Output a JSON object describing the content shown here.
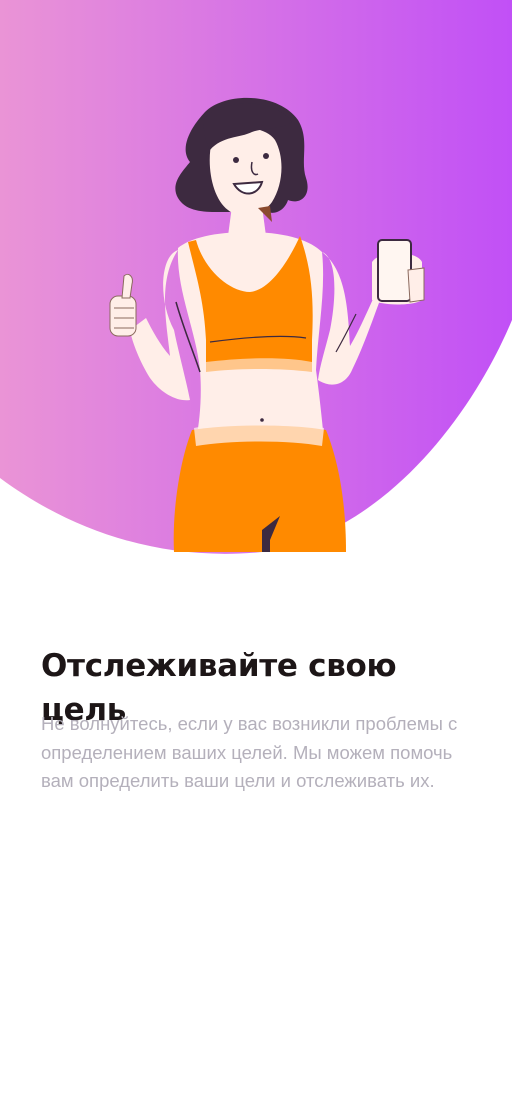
{
  "onboarding": {
    "title": "Отслеживайте свою цель",
    "description": "Не волнуйтесь, если у вас возникли проблемы с определением ваших целей. Мы можем помочь вам определить ваши цели и отслеживать их."
  },
  "colors": {
    "gradient_start": "#EA94D6",
    "gradient_end": "#C150F6",
    "title": "#1D1617",
    "description": "#B4B0BB",
    "outfit": "#FF8A00",
    "skin": "#FFEEE8",
    "hair": "#3D2A40"
  },
  "illustration": {
    "name": "woman-thumbs-up-phone-illustration"
  }
}
